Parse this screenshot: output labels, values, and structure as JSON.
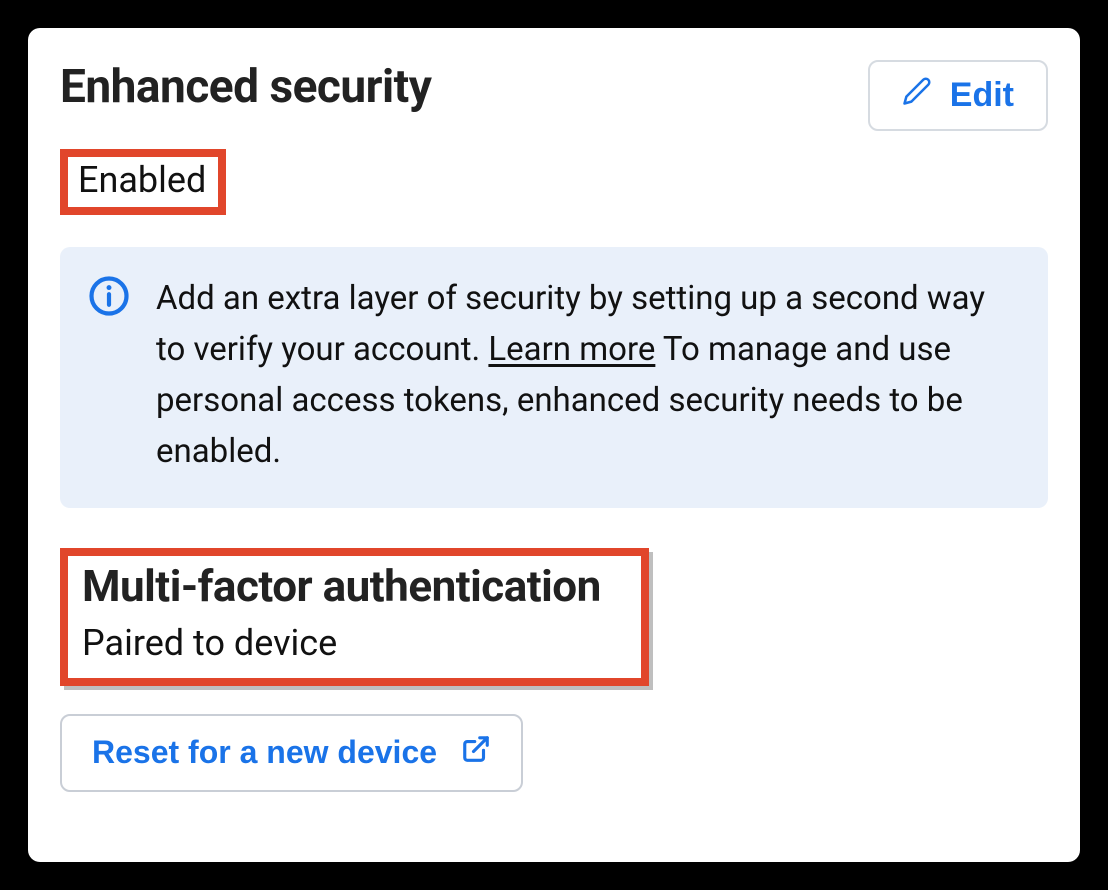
{
  "header": {
    "title": "Enhanced security",
    "edit_label": "Edit"
  },
  "status": "Enabled",
  "info": {
    "text_before_link": "Add an extra layer of security by setting up a second way to verify your account. ",
    "link_text": "Learn more",
    "text_after_link": " To manage and use personal access tokens, enhanced security needs to be enabled."
  },
  "mfa": {
    "title": "Multi-factor authentication",
    "status": "Paired to device",
    "reset_label": "Reset for a new device"
  }
}
